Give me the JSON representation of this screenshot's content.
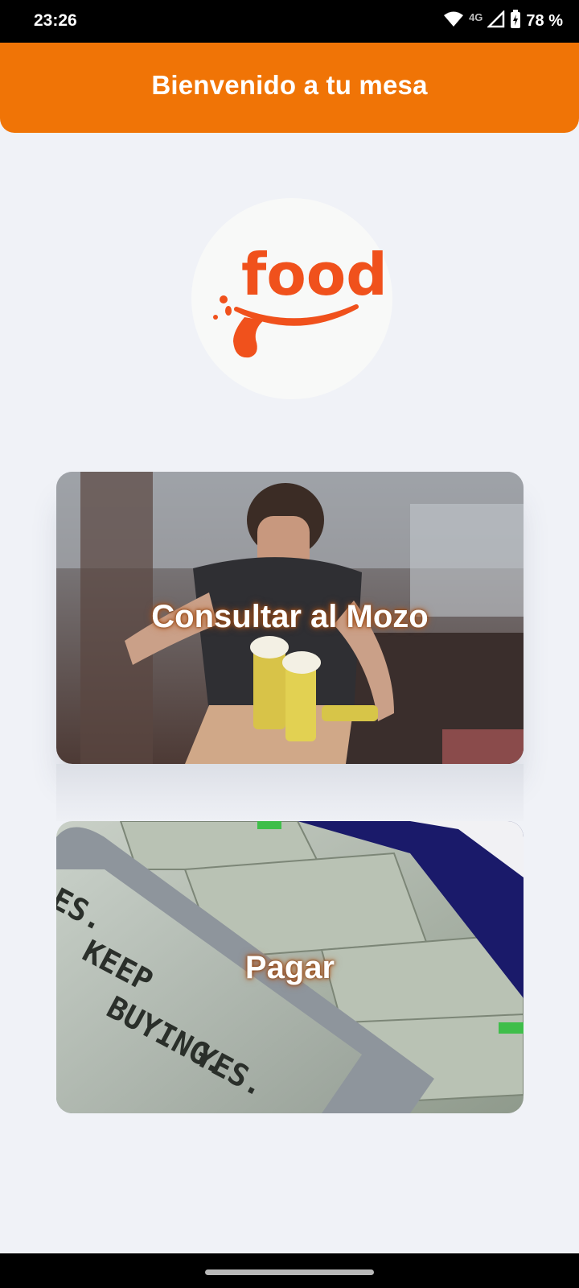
{
  "status_bar": {
    "time": "23:26",
    "network": "4G",
    "battery": "78 %",
    "icons": [
      "wifi-icon",
      "signal-icon",
      "battery-charging-icon"
    ]
  },
  "header": {
    "title": "Bienvenido a tu mesa",
    "color": "#f07406"
  },
  "logo": {
    "text": "food",
    "color": "#f0511c"
  },
  "cards": {
    "mozo": {
      "label": "Consultar al Mozo"
    },
    "pagar": {
      "label": "Pagar"
    }
  },
  "colors": {
    "background": "#f0f2f7",
    "accent": "#f07406"
  }
}
